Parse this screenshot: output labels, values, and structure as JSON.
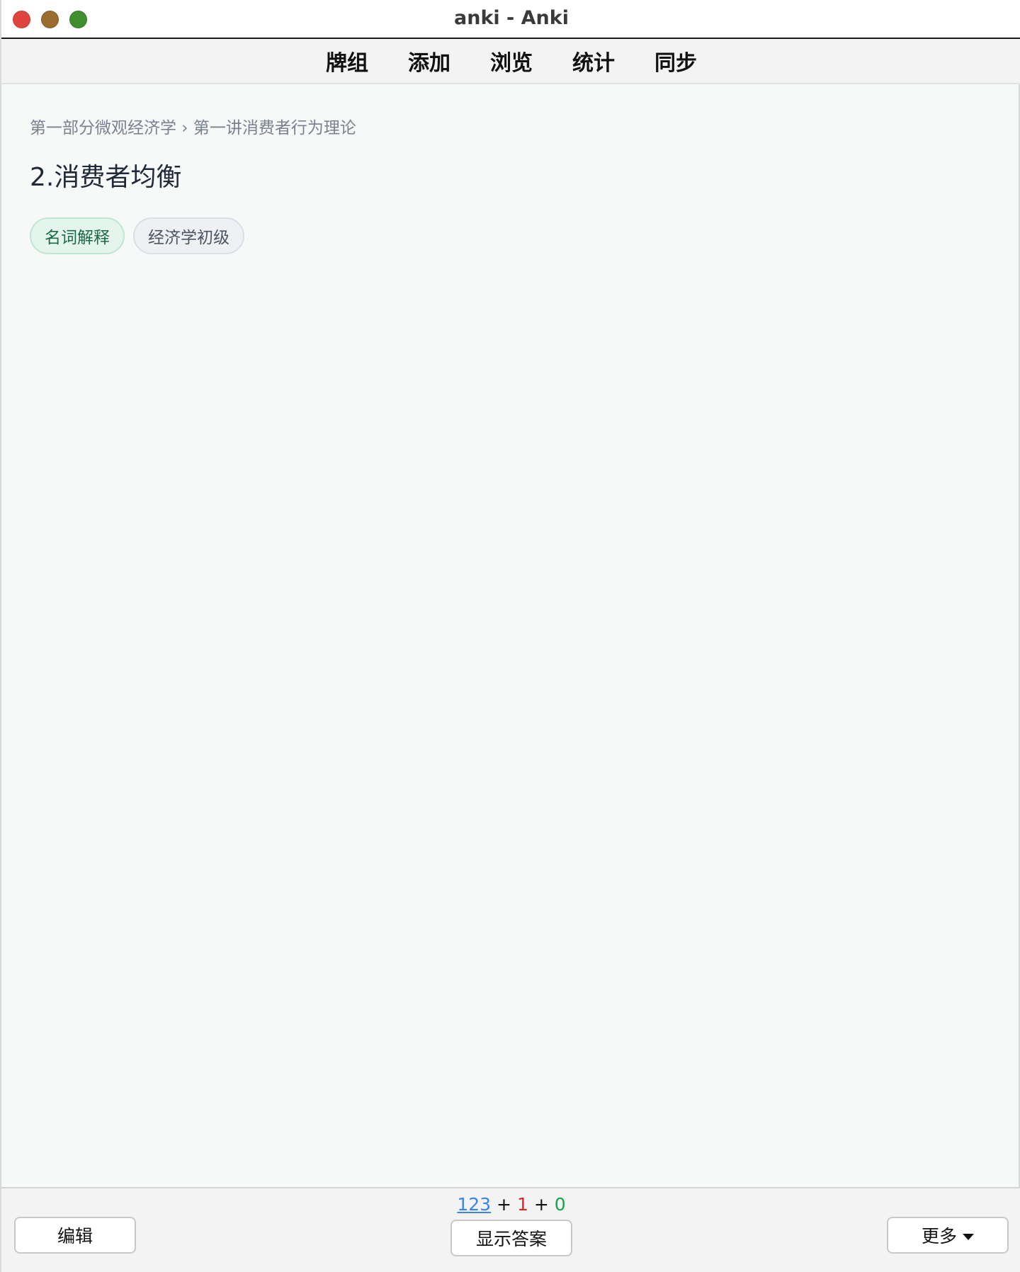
{
  "window": {
    "title": "anki - Anki"
  },
  "toolbar": {
    "items": [
      {
        "label": "牌组"
      },
      {
        "label": "添加"
      },
      {
        "label": "浏览"
      },
      {
        "label": "统计"
      },
      {
        "label": "同步"
      }
    ]
  },
  "card": {
    "breadcrumb": "第一部分微观经济学 › 第一讲消费者行为理论",
    "title": "2.消费者均衡",
    "tags": [
      {
        "label": "名词解释",
        "color": "#e3f5ec"
      },
      {
        "label": "经济学初级",
        "color": "#eef0f4"
      }
    ]
  },
  "bottom": {
    "counts": {
      "new": "123",
      "plus1": "+",
      "learn": "1",
      "plus2": "+",
      "review": "0",
      "new_color": "#3b82f6",
      "learn_color": "#dc2626",
      "review_color": "#16a34a"
    },
    "edit_label": "编辑",
    "show_answer_label": "显示答案",
    "more_label": "更多"
  }
}
